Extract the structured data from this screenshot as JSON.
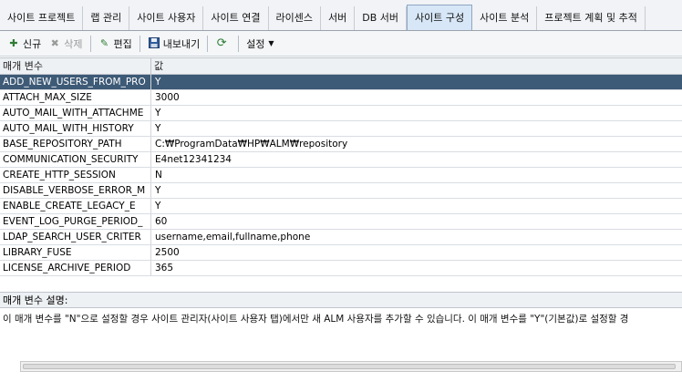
{
  "tabs": [
    {
      "label": "사이트 프로젝트"
    },
    {
      "label": "랩 관리"
    },
    {
      "label": "사이트 사용자"
    },
    {
      "label": "사이트 연결"
    },
    {
      "label": "라이센스"
    },
    {
      "label": "서버"
    },
    {
      "label": "DB 서버"
    },
    {
      "label": "사이트 구성",
      "active": true
    },
    {
      "label": "사이트 분석"
    },
    {
      "label": "프로젝트 계획 및 추적"
    }
  ],
  "toolbar": {
    "new_label": "신규",
    "delete_label": "삭제",
    "edit_label": "편집",
    "export_label": "내보내기",
    "settings_label": "설정"
  },
  "grid": {
    "col_param": "매개 변수",
    "col_value": "값",
    "rows": [
      {
        "name": "ADD_NEW_USERS_FROM_PRO",
        "value": "Y"
      },
      {
        "name": "ATTACH_MAX_SIZE",
        "value": "3000"
      },
      {
        "name": "AUTO_MAIL_WITH_ATTACHME",
        "value": "Y"
      },
      {
        "name": "AUTO_MAIL_WITH_HISTORY",
        "value": "Y"
      },
      {
        "name": "BASE_REPOSITORY_PATH",
        "value": "C:₩ProgramData₩HP₩ALM₩repository"
      },
      {
        "name": "COMMUNICATION_SECURITY",
        "value": "E4net12341234"
      },
      {
        "name": "CREATE_HTTP_SESSION",
        "value": "N"
      },
      {
        "name": "DISABLE_VERBOSE_ERROR_M",
        "value": "Y"
      },
      {
        "name": "ENABLE_CREATE_LEGACY_E",
        "value": "Y"
      },
      {
        "name": "EVENT_LOG_PURGE_PERIOD_",
        "value": "60"
      },
      {
        "name": "LDAP_SEARCH_USER_CRITER",
        "value": "username,email,fullname,phone"
      },
      {
        "name": "LIBRARY_FUSE",
        "value": "2500"
      },
      {
        "name": "LICENSE_ARCHIVE_PERIOD",
        "value": "365"
      }
    ]
  },
  "description": {
    "label": "매개 변수 설명:",
    "text": "이 매개 변수를 \"N\"으로 설정할 경우 사이트 관리자(사이트 사용자 탭)에서만 새 ALM 사용자를 추가할 수 있습니다. 이 매개 변수를 \"Y\"(기본값)로 설정할 경"
  },
  "colors": {
    "selected_row": "#3d5a76",
    "active_tab": "#d7e7f7"
  }
}
